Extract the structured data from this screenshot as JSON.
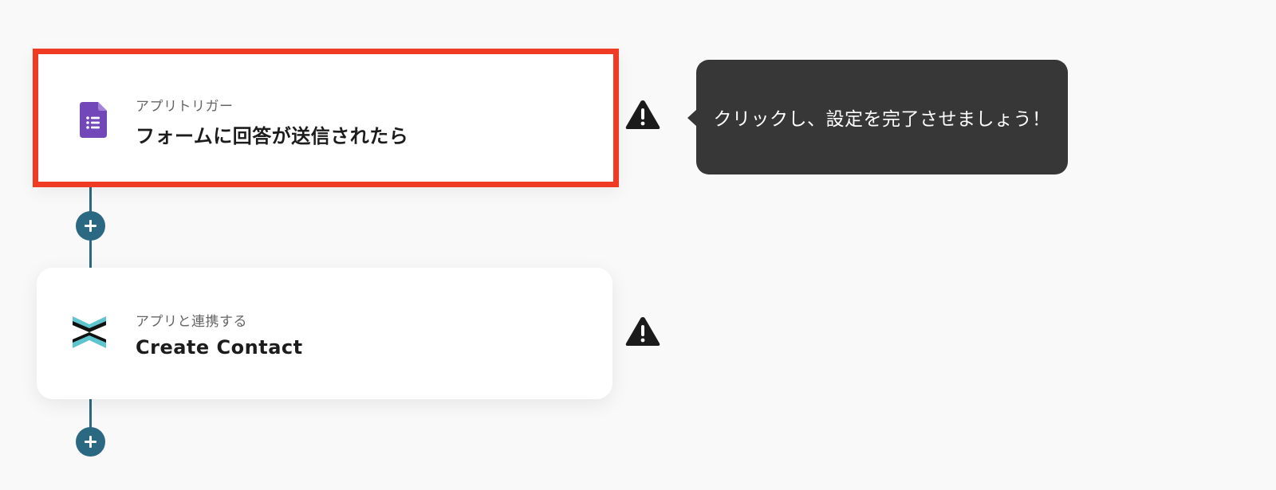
{
  "flow": {
    "trigger": {
      "subtitle": "アプリトリガー",
      "title": "フォームに回答が送信されたら",
      "icon": "google-forms-icon",
      "highlight_color": "#ef3b24"
    },
    "action": {
      "subtitle": "アプリと連携する",
      "title": "Create Contact",
      "icon": "app-logo-icon"
    },
    "tooltip": {
      "text": "クリックし、設定を完了させましょう！"
    },
    "colors": {
      "connector": "#2b6881",
      "tooltip_bg": "#373737",
      "background": "#f9f9f9"
    }
  }
}
